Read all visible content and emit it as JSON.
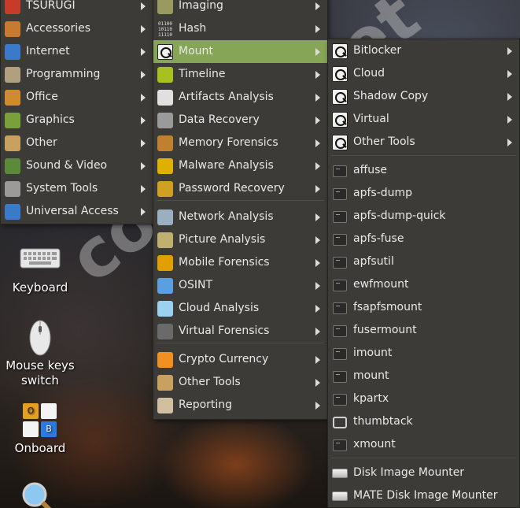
{
  "main_menu": {
    "items": [
      {
        "label": "TSURUGI",
        "icon": "tsurugi-logo-icon",
        "color": "#c83a2a"
      },
      {
        "label": "Accessories",
        "icon": "accessories-icon",
        "color": "#c87a30"
      },
      {
        "label": "Internet",
        "icon": "globe-icon",
        "color": "#3a7ac8"
      },
      {
        "label": "Programming",
        "icon": "programming-icon",
        "color": "#b0a080"
      },
      {
        "label": "Office",
        "icon": "office-icon",
        "color": "#d08a30"
      },
      {
        "label": "Graphics",
        "icon": "graphics-icon",
        "color": "#7aa03a"
      },
      {
        "label": "Other",
        "icon": "other-icon",
        "color": "#c8a060"
      },
      {
        "label": "Sound & Video",
        "icon": "sound-video-icon",
        "color": "#5a8a3a"
      },
      {
        "label": "System Tools",
        "icon": "system-tools-icon",
        "color": "#9a9a9a"
      },
      {
        "label": "Universal Access",
        "icon": "accessibility-icon",
        "color": "#3a7ac8"
      }
    ]
  },
  "submenu": {
    "items": [
      {
        "label": "Imaging",
        "icon": "imaging-icon",
        "color": "#9a9a60"
      },
      {
        "label": "Hash",
        "icon": "hash-icon",
        "glyph": "01100\n10110\n11110"
      },
      {
        "label": "Mount",
        "icon": "mount-icon",
        "active": true
      },
      {
        "label": "Timeline",
        "icon": "timeline-icon",
        "color": "#a8c020"
      },
      {
        "label": "Artifacts Analysis",
        "icon": "footprints-icon",
        "color": "#e0e0e0"
      },
      {
        "label": "Data Recovery",
        "icon": "trash-icon",
        "color": "#9a9a9a"
      },
      {
        "label": "Memory Forensics",
        "icon": "memory-icon",
        "color": "#c08030"
      },
      {
        "label": "Malware Analysis",
        "icon": "biohazard-icon",
        "color": "#e0b000"
      },
      {
        "label": "Password Recovery",
        "icon": "padlock-icon",
        "color": "#d0a020"
      },
      {
        "label": "Network Analysis",
        "icon": "network-icon",
        "color": "#9ab0c0"
      },
      {
        "label": "Picture Analysis",
        "icon": "picture-icon",
        "color": "#c0b070"
      },
      {
        "label": "Mobile Forensics",
        "icon": "mobile-icon",
        "color": "#e0a000"
      },
      {
        "label": "OSINT",
        "icon": "magnifier-icon",
        "color": "#5aa0e0"
      },
      {
        "label": "Cloud Analysis",
        "icon": "cloud-icon",
        "color": "#9ad0f0"
      },
      {
        "label": "Virtual Forensics",
        "icon": "virtual-forensics-icon",
        "color": "#6a6a6a"
      },
      {
        "label": "Crypto Currency",
        "icon": "bitcoin-icon",
        "color": "#f09020"
      },
      {
        "label": "Other Tools",
        "icon": "other-tools-icon",
        "color": "#c8a060"
      },
      {
        "label": "Reporting",
        "icon": "reporting-icon",
        "color": "#d0c0a0"
      }
    ]
  },
  "mount_menu": {
    "folders": [
      {
        "label": "Bitlocker"
      },
      {
        "label": "Cloud"
      },
      {
        "label": "Shadow Copy"
      },
      {
        "label": "Virtual"
      },
      {
        "label": "Other Tools"
      }
    ],
    "tools": [
      {
        "label": "affuse"
      },
      {
        "label": "apfs-dump"
      },
      {
        "label": "apfs-dump-quick"
      },
      {
        "label": "apfs-fuse"
      },
      {
        "label": "apfsutil"
      },
      {
        "label": "ewfmount"
      },
      {
        "label": "fsapfsmount"
      },
      {
        "label": "fusermount"
      },
      {
        "label": "imount"
      },
      {
        "label": "mount"
      },
      {
        "label": "kpartx"
      },
      {
        "label": "thumbtack"
      },
      {
        "label": "xmount"
      }
    ],
    "apps": [
      {
        "label": "Disk Image Mounter"
      },
      {
        "label": "MATE Disk Image Mounter"
      }
    ]
  },
  "desktop": {
    "icons": [
      {
        "label": "Keyboard"
      },
      {
        "label": "Mouse keys\nswitch"
      },
      {
        "label": "Onboard"
      }
    ],
    "onboard_keys": {
      "a": "O",
      "b": "B"
    }
  },
  "watermark": "codeby.net",
  "colors": {
    "menu_bg": "#3c3b37",
    "highlight": "#87a556",
    "text": "#e8e8e6"
  }
}
